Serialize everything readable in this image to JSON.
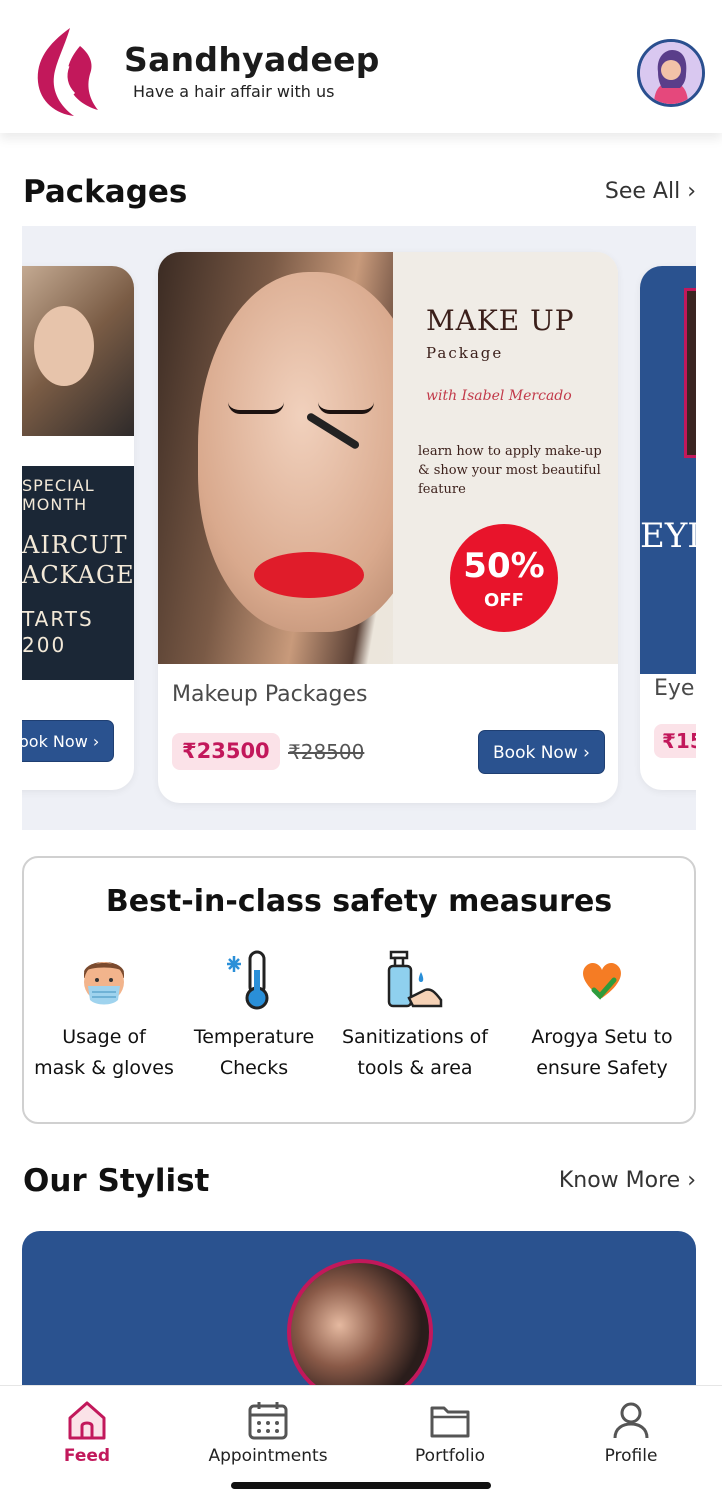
{
  "app": {
    "brand_name": "Sandhyadeep",
    "tagline": "Have a hair affair with us",
    "accent_color": "#c2185b",
    "primary_color": "#2a528f"
  },
  "packages": {
    "title": "Packages",
    "see_all": "See All ›",
    "cards": [
      {
        "promo_lines": [
          "SPECIAL",
          "MONTH",
          "AIRCUT",
          "ACKAGE",
          "TARTS",
          "200"
        ],
        "book_label": "ook Now ›"
      },
      {
        "name": "Makeup Packages",
        "price": "₹23500",
        "old_price": "₹28500",
        "book_label": "Book Now ›",
        "image_text": {
          "title": "MAKE UP",
          "subtitle": "Package",
          "signature": "with Isabel Mercado",
          "description": "learn how to apply make-up & show your most beautiful feature",
          "discount": "50%",
          "discount_suffix": "OFF"
        }
      },
      {
        "name": "Eyel",
        "price": "₹15",
        "image_text": "EYI"
      }
    ]
  },
  "safety": {
    "title": "Best-in-class safety measures",
    "items": [
      {
        "icon": "mask-face-icon",
        "line1": "Usage of",
        "line2": "mask & gloves"
      },
      {
        "icon": "thermometer-icon",
        "line1": "Temperature",
        "line2": "Checks"
      },
      {
        "icon": "sanitizer-icon",
        "line1": "Sanitizations of",
        "line2": "tools & area"
      },
      {
        "icon": "heart-check-icon",
        "line1": "Arogya Setu to",
        "line2": "ensure Safety"
      }
    ]
  },
  "stylist": {
    "title": "Our Stylist",
    "know_more": "Know More ›"
  },
  "nav": {
    "items": [
      {
        "label": "Feed",
        "icon": "home-icon",
        "active": true
      },
      {
        "label": "Appointments",
        "icon": "calendar-icon",
        "active": false
      },
      {
        "label": "Portfolio",
        "icon": "folder-icon",
        "active": false
      },
      {
        "label": "Profile",
        "icon": "user-icon",
        "active": false
      }
    ]
  }
}
